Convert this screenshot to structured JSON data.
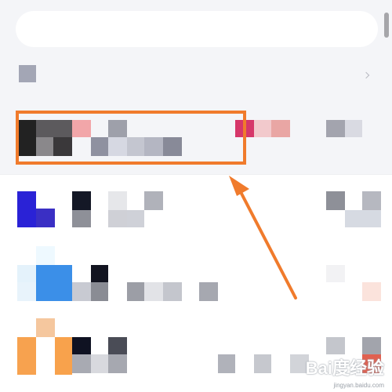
{
  "search": {
    "placeholder": ""
  },
  "colors": {
    "top_background": "#f4f5f8",
    "highlight": "#f07b2c",
    "arrow": "#f07b2c"
  },
  "icons": [
    "chevron-right-icon"
  ],
  "watermark": {
    "main": "Bai度经验",
    "sub": "jingyan.baidu.com"
  }
}
